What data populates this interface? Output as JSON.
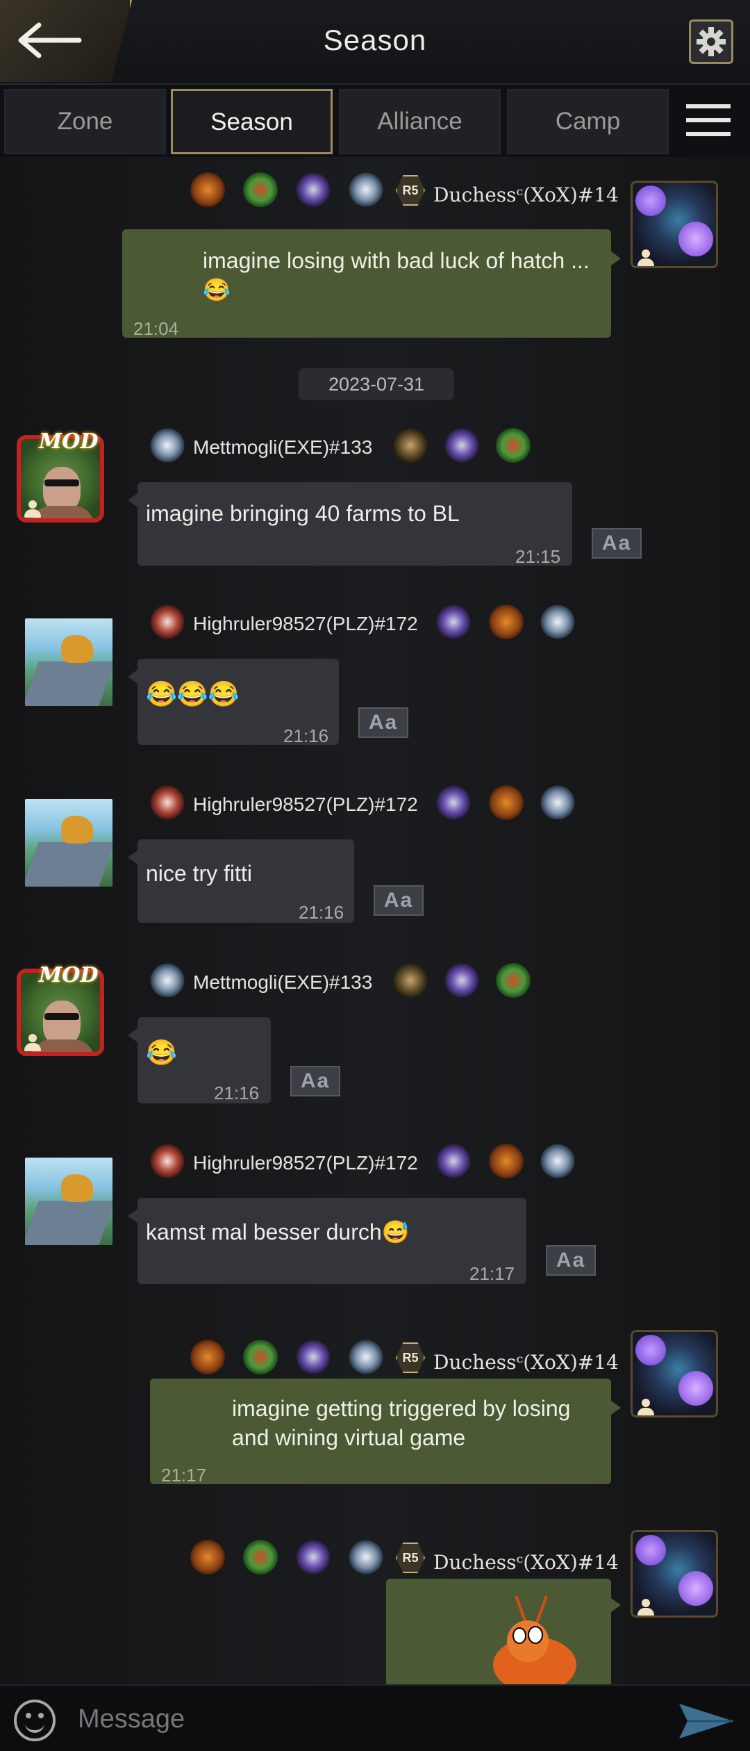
{
  "header": {
    "title": "Season"
  },
  "tabs": [
    {
      "label": "Zone"
    },
    {
      "label": "Season"
    },
    {
      "label": "Alliance"
    },
    {
      "label": "Camp"
    }
  ],
  "date_separator": "2023-07-31",
  "translate_label": "Aa",
  "mod_label": "MOD",
  "rank_badge": "R5",
  "messages": [
    {
      "sender": "Duchessᶜ(XoX)#14",
      "text": "imagine losing with bad luck of hatch ... 😂",
      "time": "21:04"
    },
    {
      "sender": "Mettmogli(EXE)#133",
      "text": "imagine bringing 40 farms to BL",
      "time": "21:15"
    },
    {
      "sender": "Highruler98527(PLZ)#172",
      "text": "😂😂😂",
      "time": "21:16"
    },
    {
      "sender": "Highruler98527(PLZ)#172",
      "text": "nice try fitti",
      "time": "21:16"
    },
    {
      "sender": "Mettmogli(EXE)#133",
      "text": "😂",
      "time": "21:16"
    },
    {
      "sender": "Highruler98527(PLZ)#172",
      "text": "kamst mal besser durch😅",
      "time": "21:17"
    },
    {
      "sender": "Duchessᶜ(XoX)#14",
      "text": "imagine getting triggered by losing and wining virtual game",
      "time": "21:17"
    },
    {
      "sender": "Duchessᶜ(XoX)#14",
      "text": "",
      "time": ""
    }
  ],
  "input": {
    "placeholder": "Message"
  },
  "icons": {
    "back": "back-arrow-icon",
    "settings": "gear-icon",
    "menu": "list-menu-icon",
    "emoji": "emoji-icon",
    "send": "send-icon"
  },
  "colors": {
    "own_bubble": "#4b5a35",
    "other_bubble": "#34353a",
    "gold_accent": "#9f8b5d",
    "mod_frame": "#c5221f"
  }
}
